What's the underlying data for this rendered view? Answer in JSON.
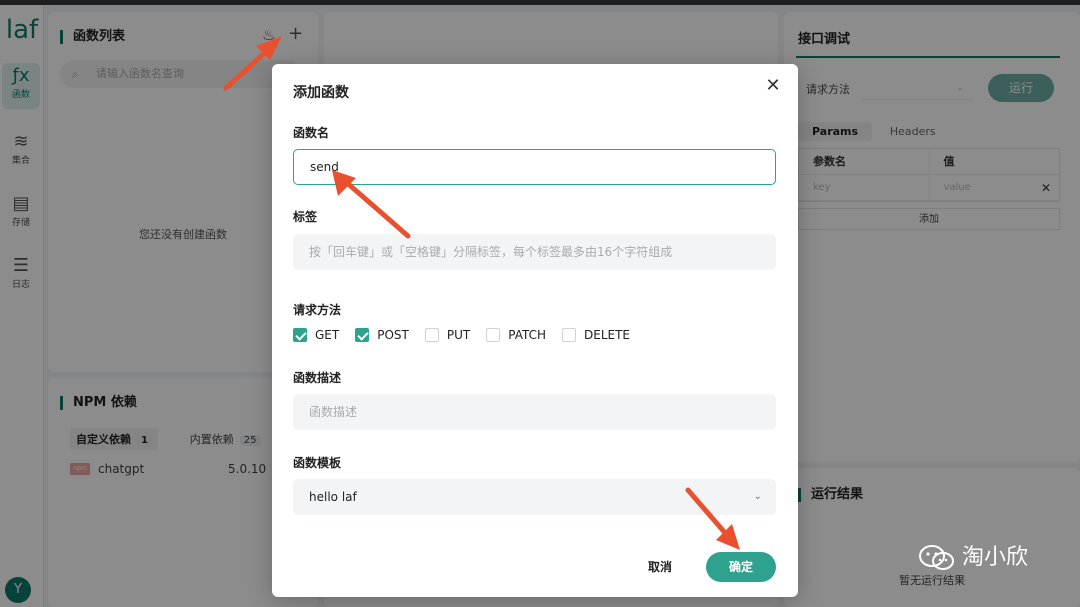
{
  "app": {
    "logo": "laf",
    "avatar": "Y",
    "rail": [
      {
        "icon": "function-icon",
        "glyph": "ƒx",
        "label": "函数"
      },
      {
        "icon": "database-icon",
        "glyph": "≋",
        "label": "集合"
      },
      {
        "icon": "storage-icon",
        "glyph": "▤",
        "label": "存储"
      },
      {
        "icon": "log-icon",
        "glyph": "☰",
        "label": "日志"
      }
    ]
  },
  "function_list": {
    "title": "函数列表",
    "search_placeholder": "请输入函数名查询",
    "empty_text": "您还没有创建函数"
  },
  "npm": {
    "title": "NPM 依赖",
    "tabs": [
      {
        "label": "自定义依赖",
        "count": "1"
      },
      {
        "label": "内置依赖",
        "count": "25"
      }
    ],
    "packages": [
      {
        "name": "chatgpt",
        "version": "5.0.10",
        "logo_text": "npm"
      }
    ]
  },
  "api_debug": {
    "title": "接口调试",
    "method_label": "请求方法",
    "run_label": "运行",
    "tabs": [
      "Params",
      "Headers"
    ],
    "table_headers": [
      "参数名",
      "值"
    ],
    "key_placeholder": "key",
    "value_placeholder": "value",
    "add_label": "添加"
  },
  "run_result": {
    "title": "运行结果",
    "empty_text": "暂无运行结果"
  },
  "modal": {
    "title": "添加函数",
    "close_glyph": "✕",
    "name_label": "函数名",
    "name_value": "send",
    "tags_label": "标签",
    "tags_placeholder": "按「回车键」或「空格键」分隔标签，每个标签最多由16个字符组成",
    "methods_label": "请求方法",
    "methods": [
      {
        "label": "GET",
        "checked": true
      },
      {
        "label": "POST",
        "checked": true
      },
      {
        "label": "PUT",
        "checked": false
      },
      {
        "label": "PATCH",
        "checked": false
      },
      {
        "label": "DELETE",
        "checked": false
      }
    ],
    "desc_label": "函数描述",
    "desc_placeholder": "函数描述",
    "template_label": "函数模板",
    "template_value": "hello laf",
    "cancel_label": "取消",
    "ok_label": "确定"
  },
  "watermark": {
    "text": "淘小欣"
  },
  "colors": {
    "accent": "#2ea28f",
    "brand": "#0e7a6c",
    "arrow": "#e8502f"
  }
}
